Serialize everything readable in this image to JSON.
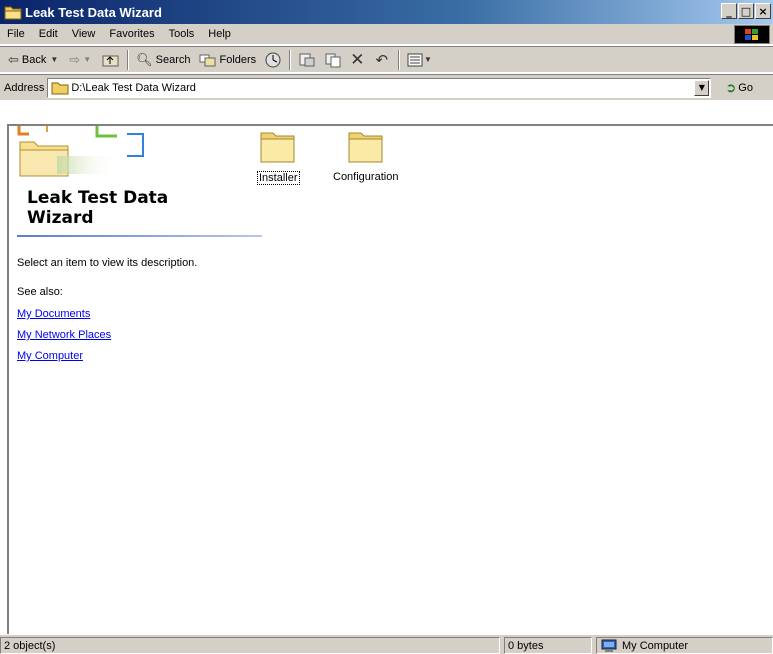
{
  "window": {
    "title": "Leak Test Data Wizard"
  },
  "menu": {
    "items": [
      "File",
      "Edit",
      "View",
      "Favorites",
      "Tools",
      "Help"
    ]
  },
  "toolbar": {
    "back_label": "Back",
    "search_label": "Search",
    "folders_label": "Folders"
  },
  "address": {
    "label": "Address",
    "value": "D:\\Leak Test Data Wizard",
    "go_label": "Go"
  },
  "left_pane": {
    "title_line1": "Leak Test Data",
    "title_line2": "Wizard",
    "description": "Select an item to view its description.",
    "see_also_label": "See also:",
    "links": [
      "My Documents",
      "My Network Places",
      "My Computer"
    ]
  },
  "files": [
    {
      "name": "Installer",
      "icon": "folder-icon",
      "focused": true
    },
    {
      "name": "Configuration",
      "icon": "folder-icon",
      "focused": false
    }
  ],
  "status": {
    "objects": "2 object(s)",
    "size": "0 bytes",
    "zone": "My Computer"
  },
  "colors": {
    "title_gradient_start": "#0a246a",
    "title_gradient_end": "#a6caf0",
    "chrome": "#d4d0c8",
    "link": "#0000ee"
  }
}
